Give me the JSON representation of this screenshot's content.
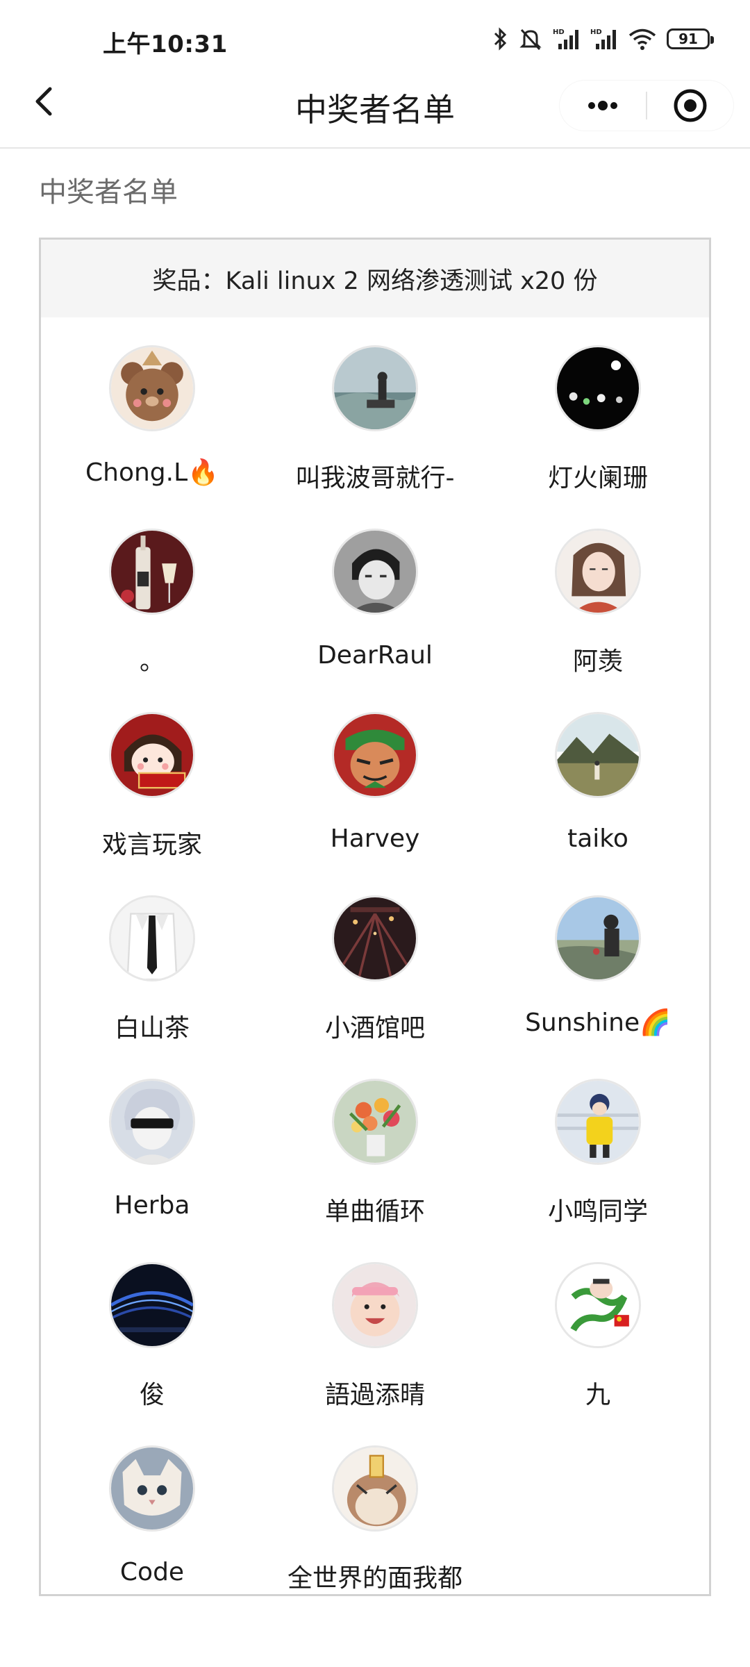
{
  "status_bar": {
    "time": "上午10:31",
    "battery": "91"
  },
  "nav": {
    "title": "中奖者名单"
  },
  "section_title": "中奖者名单",
  "prize": {
    "text": "奖品：Kali linux 2 网络渗透测试 x20 份"
  },
  "winners": [
    {
      "name": "Chong.L🔥"
    },
    {
      "name": "叫我波哥就行-"
    },
    {
      "name": "灯火阑珊"
    },
    {
      "name": "。"
    },
    {
      "name": "DearRaul"
    },
    {
      "name": "阿羡"
    },
    {
      "name": "戏言玩家"
    },
    {
      "name": "Harvey"
    },
    {
      "name": "taiko"
    },
    {
      "name": "白山茶"
    },
    {
      "name": "小酒馆吧"
    },
    {
      "name": "Sunshine🌈"
    },
    {
      "name": "Herba"
    },
    {
      "name": "单曲循环"
    },
    {
      "name": "小鸣同学"
    },
    {
      "name": "俊"
    },
    {
      "name": "語過添晴"
    },
    {
      "name": "九"
    },
    {
      "name": "Code"
    },
    {
      "name": "全世界的面我都"
    }
  ]
}
